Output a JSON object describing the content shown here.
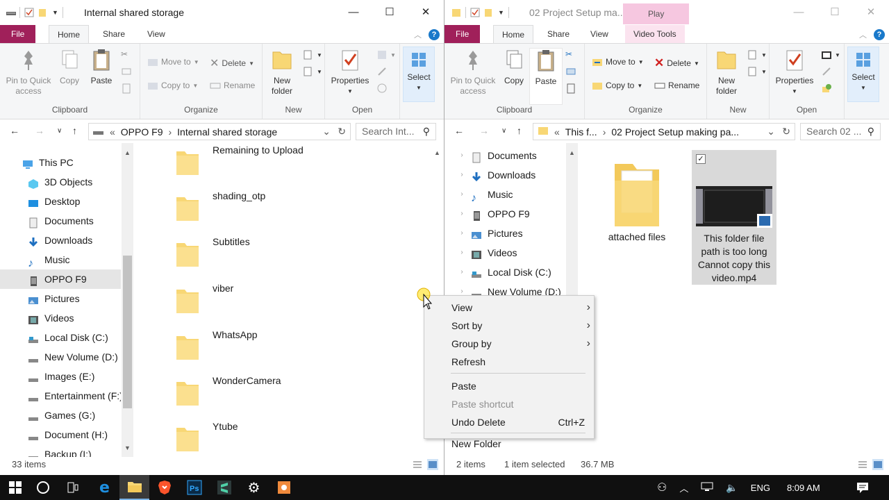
{
  "left": {
    "title": "Internal shared storage",
    "tabs": {
      "file": "File",
      "home": "Home",
      "share": "Share",
      "view": "View"
    },
    "ribbon": {
      "clipboard": {
        "label": "Clipboard",
        "pin": "Pin to Quick access",
        "copy": "Copy",
        "paste": "Paste"
      },
      "organize": {
        "label": "Organize",
        "move_to": "Move to",
        "copy_to": "Copy to",
        "delete": "Delete",
        "rename": "Rename"
      },
      "new": {
        "label": "New",
        "new_folder": "New folder"
      },
      "open": {
        "label": "Open",
        "properties": "Properties"
      },
      "select": {
        "label": "Select"
      }
    },
    "address": {
      "root": "«",
      "segments": [
        "OPPO F9",
        "Internal shared storage"
      ]
    },
    "search_placeholder": "Search Int...",
    "tree": [
      {
        "label": "This PC",
        "icon": "this-pc-icon"
      },
      {
        "label": "3D Objects",
        "icon": "3d-objects-icon"
      },
      {
        "label": "Desktop",
        "icon": "desktop-icon"
      },
      {
        "label": "Documents",
        "icon": "documents-icon"
      },
      {
        "label": "Downloads",
        "icon": "downloads-icon"
      },
      {
        "label": "Music",
        "icon": "music-icon"
      },
      {
        "label": "OPPO F9",
        "icon": "phone-icon",
        "selected": true
      },
      {
        "label": "Pictures",
        "icon": "pictures-icon"
      },
      {
        "label": "Videos",
        "icon": "videos-icon"
      },
      {
        "label": "Local Disk (C:)",
        "icon": "local-disk-icon"
      },
      {
        "label": "New Volume (D:)",
        "icon": "drive-icon"
      },
      {
        "label": "Images (E:)",
        "icon": "drive-icon"
      },
      {
        "label": "Entertainment (F:)",
        "icon": "drive-icon"
      },
      {
        "label": "Games (G:)",
        "icon": "drive-icon"
      },
      {
        "label": "Document (H:)",
        "icon": "drive-icon"
      },
      {
        "label": "Backup (I:)",
        "icon": "drive-icon"
      }
    ],
    "files": [
      "Remaining to Upload",
      "shading_otp",
      "Subtitles",
      "viber",
      "WhatsApp",
      "WonderCamera",
      "Ytube"
    ],
    "status": "33 items"
  },
  "right": {
    "title": "02 Project Setup ma...",
    "contextual_tab": "Play",
    "tabs": {
      "file": "File",
      "home": "Home",
      "share": "Share",
      "view": "View",
      "video_tools": "Video Tools"
    },
    "ribbon": {
      "clipboard": {
        "label": "Clipboard",
        "pin": "Pin to Quick access",
        "copy": "Copy",
        "paste": "Paste"
      },
      "organize": {
        "label": "Organize",
        "move_to": "Move to",
        "copy_to": "Copy to",
        "delete": "Delete",
        "rename": "Rename"
      },
      "new": {
        "label": "New",
        "new_folder": "New folder"
      },
      "open": {
        "label": "Open",
        "properties": "Properties"
      },
      "select": {
        "label": "Select"
      }
    },
    "address": {
      "root": "«",
      "segments": [
        "This f...",
        "02 Project Setup making pa..."
      ]
    },
    "search_placeholder": "Search 02 ...",
    "tree": [
      {
        "label": "Documents",
        "icon": "documents-icon"
      },
      {
        "label": "Downloads",
        "icon": "downloads-icon"
      },
      {
        "label": "Music",
        "icon": "music-icon"
      },
      {
        "label": "OPPO F9",
        "icon": "phone-icon"
      },
      {
        "label": "Pictures",
        "icon": "pictures-icon"
      },
      {
        "label": "Videos",
        "icon": "videos-icon"
      },
      {
        "label": "Local Disk (C:)",
        "icon": "local-disk-icon"
      },
      {
        "label": "New Volume (D:)",
        "icon": "drive-icon"
      }
    ],
    "items": [
      {
        "name": "attached files",
        "type": "folder"
      },
      {
        "name": "This folder file path is too long Cannot copy this video.mp4",
        "type": "video",
        "selected": true
      }
    ],
    "status": {
      "count": "2 items",
      "selection": "1 item selected",
      "size": "36.7 MB"
    }
  },
  "context_menu": {
    "items": [
      {
        "label": "View",
        "submenu": true
      },
      {
        "label": "Sort by",
        "submenu": true
      },
      {
        "label": "Group by",
        "submenu": true
      },
      {
        "label": "Refresh"
      },
      {
        "label": "Paste"
      },
      {
        "label": "Paste shortcut",
        "disabled": true
      },
      {
        "label": "Undo Delete",
        "shortcut": "Ctrl+Z"
      },
      {
        "label": "New Folder"
      }
    ]
  },
  "taskbar": {
    "apps": [
      "start-icon",
      "cortana-icon",
      "task-view-icon",
      "edge-icon",
      "file-explorer-icon",
      "brave-icon",
      "photoshop-icon",
      "sublime-icon",
      "settings-icon",
      "presentation-icon"
    ],
    "language": "ENG",
    "time": "8:09 AM"
  },
  "colors": {
    "file_tab": "#a0205a",
    "accent": "#1979ca",
    "play_tab": "#f6c7e0",
    "folder": "#f8d775",
    "selection": "#d9d9d9"
  }
}
